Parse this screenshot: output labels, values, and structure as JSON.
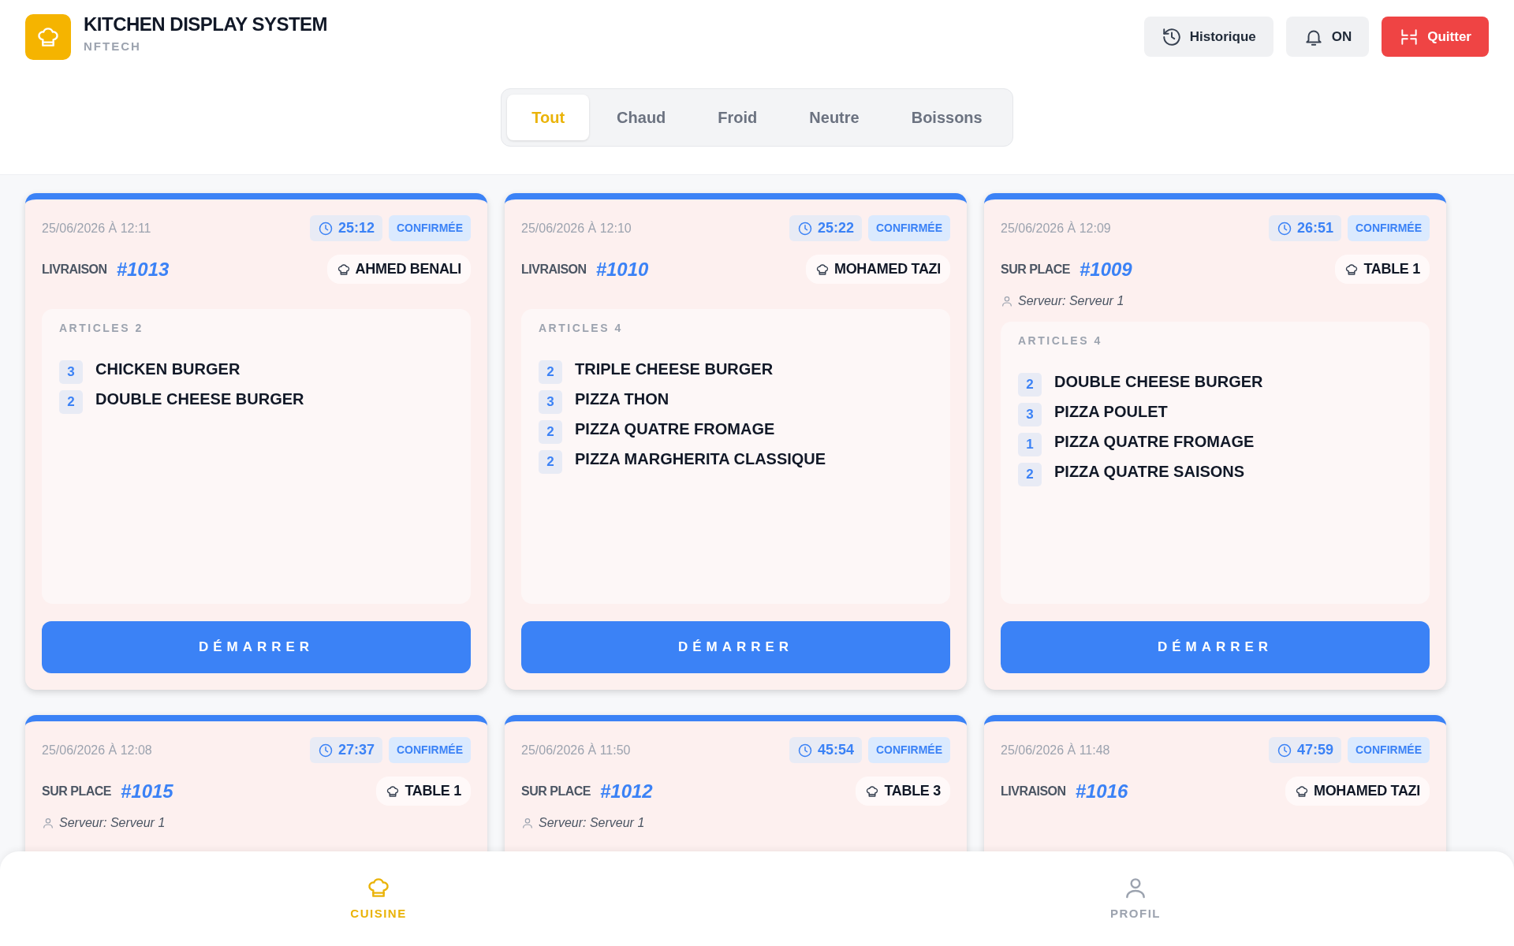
{
  "header": {
    "title": "KITCHEN DISPLAY SYSTEM",
    "subtitle": "NFTECH",
    "buttons": [
      {
        "label": "Historique",
        "kind": "history"
      },
      {
        "label": "ON",
        "kind": "bell"
      },
      {
        "label": "Quitter",
        "kind": "exit"
      }
    ]
  },
  "filters": [
    {
      "label": "Tout",
      "selected": true
    },
    {
      "label": "Chaud",
      "selected": false
    },
    {
      "label": "Froid",
      "selected": false
    },
    {
      "label": "Neutre",
      "selected": false
    },
    {
      "label": "Boissons",
      "selected": false
    }
  ],
  "orders": [
    {
      "datetime": "25/06/2026 À 12:11",
      "elapsed": "25:12",
      "status": "CONFIRMÉE",
      "type": "LIVRAISON",
      "number": "#1013",
      "customer": "AHMED BENALI",
      "articles_label": "ARTICLES 2",
      "items": [
        {
          "qty": "3",
          "name": "CHICKEN BURGER"
        },
        {
          "qty": "2",
          "name": "DOUBLE CHEESE BURGER"
        }
      ],
      "action": "DÉMARRER"
    },
    {
      "datetime": "25/06/2026 À 12:10",
      "elapsed": "25:22",
      "status": "CONFIRMÉE",
      "type": "LIVRAISON",
      "number": "#1010",
      "customer": "MOHAMED TAZI",
      "articles_label": "ARTICLES 4",
      "items": [
        {
          "qty": "2",
          "name": "TRIPLE CHEESE BURGER"
        },
        {
          "qty": "3",
          "name": "PIZZA THON"
        },
        {
          "qty": "2",
          "name": "PIZZA QUATRE FROMAGE"
        },
        {
          "qty": "2",
          "name": "PIZZA MARGHERITA CLASSIQUE"
        }
      ],
      "action": "DÉMARRER"
    },
    {
      "datetime": "25/06/2026 À 12:09",
      "elapsed": "26:51",
      "status": "CONFIRMÉE",
      "type": "SUR PLACE",
      "number": "#1009",
      "customer": "TABLE 1",
      "server": "Serveur: Serveur 1",
      "articles_label": "ARTICLES 4",
      "items": [
        {
          "qty": "2",
          "name": "DOUBLE CHEESE BURGER"
        },
        {
          "qty": "3",
          "name": "PIZZA POULET"
        },
        {
          "qty": "1",
          "name": "PIZZA QUATRE FROMAGE"
        },
        {
          "qty": "2",
          "name": "PIZZA QUATRE SAISONS"
        }
      ],
      "action": "DÉMARRER"
    },
    {
      "datetime": "25/06/2026 À 12:08",
      "elapsed": "27:37",
      "status": "CONFIRMÉE",
      "type": "SUR PLACE",
      "number": "#1015",
      "customer": "TABLE 1",
      "server": "Serveur: Serveur 1"
    },
    {
      "datetime": "25/06/2026 À 11:50",
      "elapsed": "45:54",
      "status": "CONFIRMÉE",
      "type": "SUR PLACE",
      "number": "#1012",
      "customer": "TABLE 3",
      "server": "Serveur: Serveur 1"
    },
    {
      "datetime": "25/06/2026 À 11:48",
      "elapsed": "47:59",
      "status": "CONFIRMÉE",
      "type": "LIVRAISON",
      "number": "#1016",
      "customer": "MOHAMED TAZI"
    }
  ],
  "bottom_nav": [
    {
      "label": "CUISINE",
      "kind": "chef",
      "selected": true
    },
    {
      "label": "PROFIL",
      "kind": "person",
      "selected": false
    }
  ]
}
